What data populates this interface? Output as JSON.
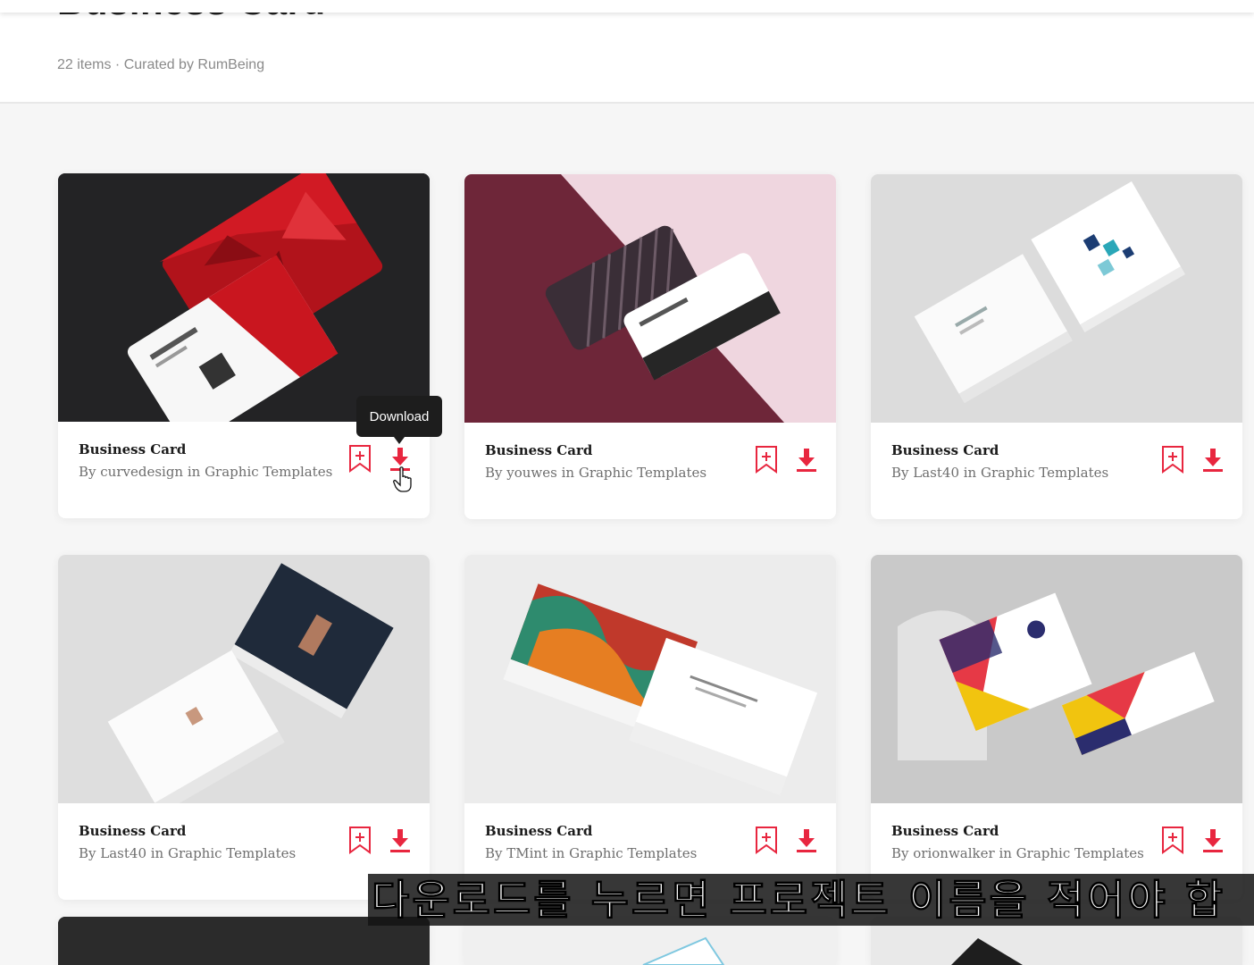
{
  "header": {
    "title": "Business Card",
    "meta": "22 items · Curated by RumBeing"
  },
  "cards": [
    {
      "title": "Business Card",
      "byline": "By curvedesign in Graphic Templates"
    },
    {
      "title": "Business Card",
      "byline": "By youwes in Graphic Templates"
    },
    {
      "title": "Business Card",
      "byline": "By Last40 in Graphic Templates"
    },
    {
      "title": "Business Card",
      "byline": "By Last40 in Graphic Templates"
    },
    {
      "title": "Business Card",
      "byline": "By TMint in Graphic Templates"
    },
    {
      "title": "Business Card",
      "byline": "By orionwalker in Graphic Templates"
    }
  ],
  "tooltip": {
    "text": "Download"
  },
  "icons": {
    "bookmark": "bookmark-add-icon",
    "download": "download-icon",
    "cursor": "hand-pointer-icon"
  },
  "colors": {
    "accent": "#e8263f",
    "tooltip_bg": "#1d1d1d"
  },
  "subtitle": {
    "text": "다운로드를 누르면 프로젝트 이름을 적어야 합"
  }
}
